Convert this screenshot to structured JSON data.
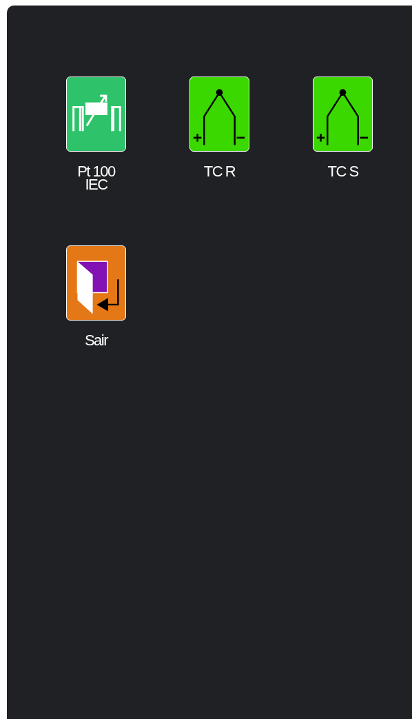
{
  "items": [
    {
      "kind": "rtd",
      "label": "Pt 100 IEC"
    },
    {
      "kind": "thermocouple",
      "label": "TC R"
    },
    {
      "kind": "thermocouple",
      "label": "TC S"
    },
    {
      "kind": "exit",
      "label": "Sair"
    }
  ]
}
